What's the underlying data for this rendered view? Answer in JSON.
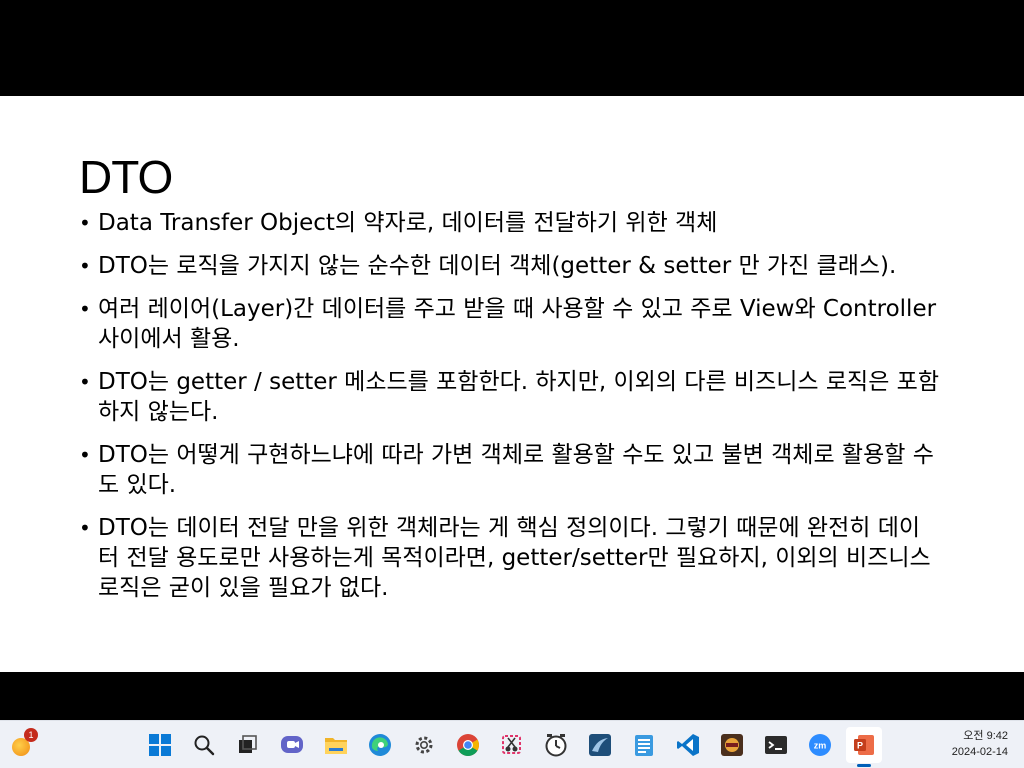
{
  "slide": {
    "title": "DTO",
    "bullets": [
      "Data Transfer Object의 약자로, 데이터를 전달하기 위한 객체",
      "DTO는 로직을 가지지 않는 순수한 데이터 객체(getter & setter 만 가진 클래스).",
      "여러 레이어(Layer)간 데이터를 주고 받을 때 사용할 수 있고 주로 View와 Controller 사이에서 활용.",
      "DTO는 getter / setter 메소드를 포함한다. 하지만, 이외의 다른 비즈니스 로직은 포함하지 않는다.",
      "DTO는 어떻게 구현하느냐에 따라 가변 객체로 활용할 수도 있고 불변 객체로 활용할 수도 있다.",
      "DTO는 데이터 전달 만을 위한 객체라는 게 핵심 정의이다. 그렇기 때문에 완전히 데이터 전달 용도로만 사용하는게 목적이라면, getter/setter만 필요하지, 이외의 비즈니스 로직은 굳이 있을 필요가 없다."
    ]
  },
  "taskbar": {
    "weather_badge": "1",
    "apps": [
      {
        "icon": "windows-start-icon"
      },
      {
        "icon": "search-icon"
      },
      {
        "icon": "task-view-icon"
      },
      {
        "icon": "chat-icon"
      },
      {
        "icon": "file-explorer-icon"
      },
      {
        "icon": "edge-browser-icon"
      },
      {
        "icon": "settings-gear-icon"
      },
      {
        "icon": "chrome-browser-icon"
      },
      {
        "icon": "snipping-tool-icon"
      },
      {
        "icon": "clock-app-icon"
      },
      {
        "icon": "mysql-workbench-icon"
      },
      {
        "icon": "notepad-icon"
      },
      {
        "icon": "vscode-icon"
      },
      {
        "icon": "game-app-icon"
      },
      {
        "icon": "terminal-icon"
      },
      {
        "icon": "zoom-icon"
      },
      {
        "icon": "powerpoint-icon",
        "active": true
      }
    ],
    "clock": {
      "time": "오전 9:42",
      "date": "2024-02-14"
    }
  }
}
